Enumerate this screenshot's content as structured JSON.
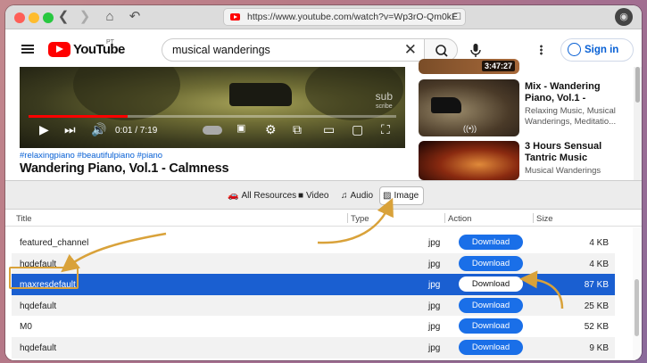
{
  "browser": {
    "url": "https://www.youtube.com/watch?v=Wp3rO-Qm0kE",
    "colors": {
      "close": "#fe5f57",
      "minimize": "#febc2e",
      "zoom": "#28c840"
    }
  },
  "youtube": {
    "logo_text": "YouTube",
    "region": "PT",
    "search_query": "musical wanderings",
    "sign_in": "Sign in",
    "video": {
      "time": "0:01 / 7:19",
      "watermark_main": "sub",
      "watermark_sub": "scribe",
      "progress_fraction": 0.27
    },
    "tags": "#relaxingpiano #beautifulpiano #piano",
    "title": "Wandering Piano, Vol.1 - Calmness",
    "recommendations": [
      {
        "duration": "3:47:27"
      },
      {
        "title": "Mix - Wandering Piano, Vol.1 -",
        "channel": "Relaxing Music, Musical Wanderings, Meditatio..."
      },
      {
        "title": "3 Hours Sensual Tantric Music",
        "channel": "Musical Wanderings"
      }
    ]
  },
  "panel": {
    "tabs": [
      {
        "label": "All Resources",
        "icon": "car-icon",
        "active": false
      },
      {
        "label": "Video",
        "icon": "video-camera-icon",
        "active": false
      },
      {
        "label": "Audio",
        "icon": "music-note-icon",
        "active": false
      },
      {
        "label": "Image",
        "icon": "image-icon",
        "active": true
      }
    ],
    "columns": {
      "title": "Title",
      "type": "Type",
      "action": "Action",
      "size": "Size"
    },
    "download_label": "Download",
    "rows": [
      {
        "title": "featured_channel",
        "type": "jpg",
        "size": "4 KB"
      },
      {
        "title": "hqdefault",
        "type": "jpg",
        "size": "4 KB"
      },
      {
        "title": "maxresdefault",
        "type": "jpg",
        "size": "87 KB"
      },
      {
        "title": "hqdefault",
        "type": "jpg",
        "size": "25 KB"
      },
      {
        "title": "M0",
        "type": "jpg",
        "size": "52 KB"
      },
      {
        "title": "hqdefault",
        "type": "jpg",
        "size": "9 KB"
      }
    ],
    "selected_row": 2,
    "colors": {
      "accent": "#1a6fe8",
      "selected": "#1a5fd1",
      "annotation": "#d9a23a"
    }
  }
}
